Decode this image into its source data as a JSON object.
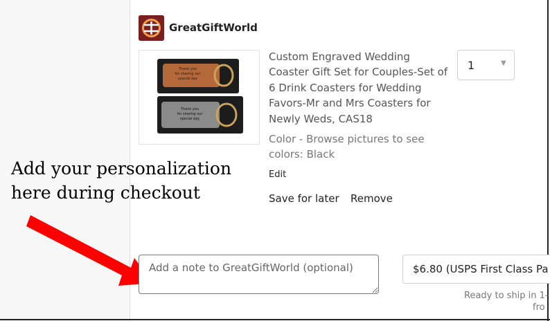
{
  "shop": {
    "name": "GreatGiftWorld",
    "logo_icon": "shop-logo-icon",
    "logo_color": "#7a1f1f"
  },
  "product": {
    "title": "Custom Engraved Wedding Coaster Gift Set for Couples-Set of 6 Drink Coasters for Wedding Favors-Mr and Mrs Coasters for Newly Weds, CAS18",
    "variation": "Color - Browse pictures to see colors: Black",
    "image_text_top": "Thank you for sharing our special day",
    "image_text_bottom": "Thank you for sharing our special day",
    "edit_label": "Edit",
    "save_for_later_label": "Save for later",
    "remove_label": "Remove"
  },
  "quantity": {
    "value": "1"
  },
  "annotation": {
    "line1": "Add your personalization",
    "line2": "here during checkout",
    "arrow_color": "#ff0000"
  },
  "note": {
    "placeholder": "Add a note to GreatGiftWorld (optional)"
  },
  "shipping": {
    "selected": "$6.80 (USPS First Class Pa",
    "ready_text": "Ready to ship in 1-",
    "from_text": "fro"
  }
}
